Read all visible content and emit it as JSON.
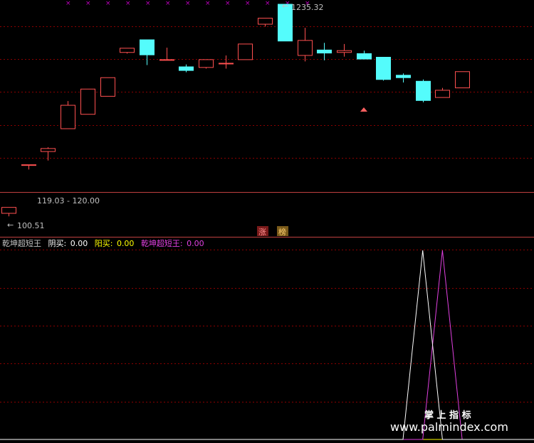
{
  "colors": {
    "background": "#000000",
    "up": "#ff5050",
    "down": "#54fcfc",
    "grid": "#8b0000",
    "separator": "#c04040",
    "text": "#c0c0c0",
    "marker": "#c000c0",
    "yinmai": "#ffffff",
    "yangmai": "#ffff00",
    "indicator": "#e040e0",
    "arrow": "#ff6060"
  },
  "main_panel": {
    "high_label": "1235.32",
    "range_label": "119.03 - 120.00",
    "low_label": "100.51",
    "badges": [
      "涨",
      "榜"
    ]
  },
  "sub_panel": {
    "legend": {
      "name": "乾坤超短王",
      "yinmai_label": "阴买:",
      "yinmai_value": "0.00",
      "yangmai_label": "阳买:",
      "yangmai_value": "0.00",
      "indicator_label": "乾坤超短王:",
      "indicator_value": "0.00"
    }
  },
  "watermark": {
    "line1": "掌 上 指 标",
    "line2": "www.palmindex.com"
  },
  "chart_data": [
    {
      "type": "candlestick",
      "series": [
        {
          "open": 100.51,
          "close": 101.5,
          "high": 101.5,
          "low": 100.0
        },
        {
          "open": 108.6,
          "close": 108.6,
          "high": 108.6,
          "low": 107.8
        },
        {
          "open": 110.8,
          "close": 111.3,
          "high": 111.5,
          "low": 109.3
        },
        {
          "open": 114.6,
          "close": 118.5,
          "high": 119.2,
          "low": 114.6
        },
        {
          "open": 117.0,
          "close": 121.2,
          "high": 121.2,
          "low": 117.0
        },
        {
          "open": 120.0,
          "close": 123.1,
          "high": 123.1,
          "low": 120.0
        },
        {
          "open": 127.3,
          "close": 128.0,
          "high": 128.0,
          "low": 127.1
        },
        {
          "open": 129.4,
          "close": 126.9,
          "high": 129.4,
          "low": 125.2
        },
        {
          "open": 126.1,
          "close": 126.1,
          "high": 128.1,
          "low": 126.1
        },
        {
          "open": 124.9,
          "close": 124.3,
          "high": 125.3,
          "low": 124.0
        },
        {
          "open": 124.8,
          "close": 126.1,
          "high": 126.1,
          "low": 124.6
        },
        {
          "open": 125.5,
          "close": 125.5,
          "high": 126.8,
          "low": 124.6
        },
        {
          "open": 126.1,
          "close": 128.7,
          "high": 128.7,
          "low": 126.1
        },
        {
          "open": 132.0,
          "close": 133.0,
          "high": 133.0,
          "low": 131.6
        },
        {
          "open": 135.32,
          "close": 129.2,
          "high": 135.32,
          "low": 129.2
        },
        {
          "open": 126.8,
          "close": 129.3,
          "high": 131.4,
          "low": 125.8
        },
        {
          "open": 127.7,
          "close": 127.2,
          "high": 128.9,
          "low": 126.0
        },
        {
          "open": 127.3,
          "close": 127.6,
          "high": 128.7,
          "low": 126.6
        },
        {
          "open": 127.1,
          "close": 126.2,
          "high": 127.6,
          "low": 126.2
        },
        {
          "open": 126.5,
          "close": 122.8,
          "high": 126.5,
          "low": 122.6
        },
        {
          "open": 123.5,
          "close": 123.1,
          "high": 123.8,
          "low": 122.3
        },
        {
          "open": 122.5,
          "close": 119.3,
          "high": 122.8,
          "low": 119.0
        },
        {
          "open": 119.8,
          "close": 121.0,
          "high": 121.4,
          "low": 119.8
        },
        {
          "open": 121.4,
          "close": 124.1,
          "high": 124.1,
          "low": 121.4
        }
      ],
      "y_scale": {
        "ticks": [
          {
            "price": 100.51,
            "label": "100.51"
          },
          {
            "price": 135.32,
            "label": "1235.32"
          }
        ]
      }
    },
    {
      "type": "line",
      "x_count": 24,
      "series": [
        {
          "name": "阴买",
          "values": [
            0,
            0,
            0,
            0,
            0,
            0,
            0,
            0,
            0,
            0,
            0,
            0,
            0,
            0,
            0,
            0,
            0,
            0,
            0,
            0,
            0,
            1,
            0,
            0
          ]
        },
        {
          "name": "阳买",
          "values": [
            0,
            0,
            0,
            0,
            0,
            0,
            0,
            0,
            0,
            0,
            0,
            0,
            0,
            0,
            0,
            0,
            0,
            0,
            0,
            0,
            0,
            0,
            0,
            0
          ]
        },
        {
          "name": "乾坤超短王",
          "values": [
            0,
            0,
            0,
            0,
            0,
            0,
            0,
            0,
            0,
            0,
            0,
            0,
            0,
            0,
            0,
            0,
            0,
            0,
            0,
            0,
            0,
            0,
            1,
            0
          ]
        }
      ]
    }
  ]
}
